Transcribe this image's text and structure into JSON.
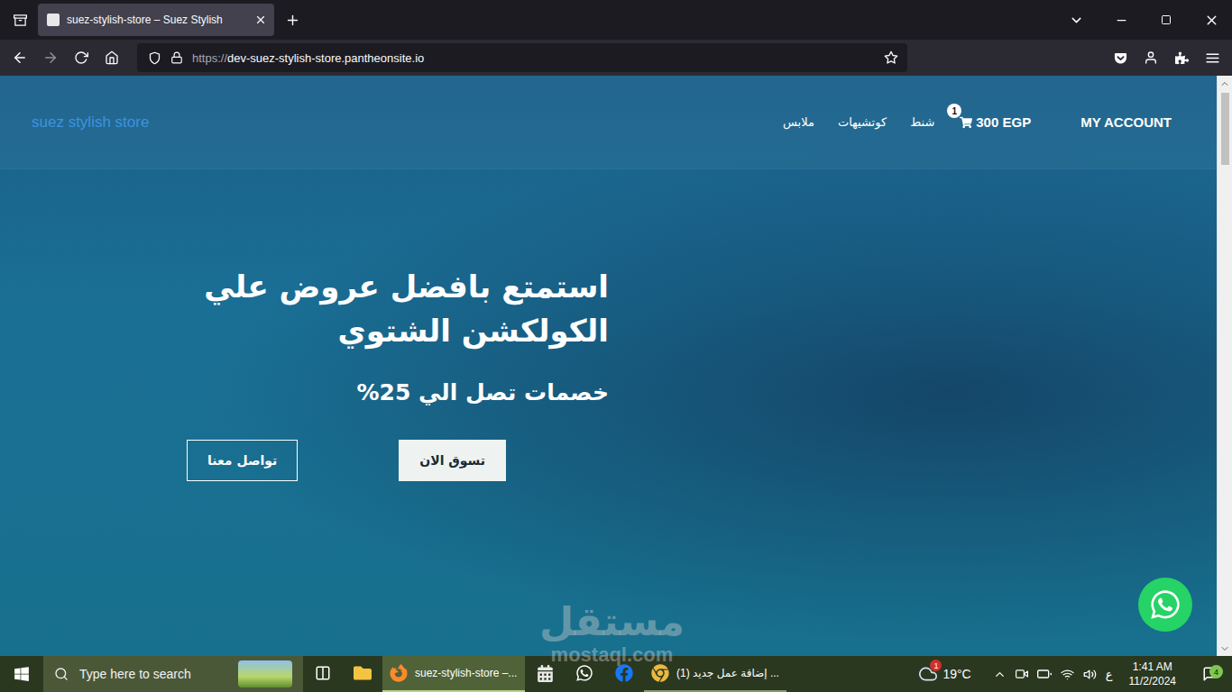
{
  "browser": {
    "tabs": [
      {
        "title": "suez-stylish-store – Suez Stylish",
        "selected": true
      }
    ],
    "url": {
      "scheme": "https://",
      "host": "dev-suez-stylish-store.pantheonsite.io"
    }
  },
  "site": {
    "logo": "suez stylish store",
    "nav": [
      {
        "label": "ملابس"
      },
      {
        "label": "كوتشيهات"
      },
      {
        "label": "شنط"
      }
    ],
    "cart": {
      "count": "1",
      "total": "300 EGP"
    },
    "account": "MY ACCOUNT"
  },
  "hero": {
    "heading": [
      "استمتع بافضل عروض علي",
      "الكولكشن الشتوي"
    ],
    "subheading": "خصمات تصل الي 25%",
    "buttons": [
      {
        "label": "تواصل معنا",
        "kind": "outline"
      },
      {
        "label": "تسوق الان",
        "kind": "filled"
      }
    ]
  },
  "watermark": {
    "arabic": "مستقل",
    "latin": "mostaql.com"
  },
  "taskbar": {
    "search_placeholder": "Type here to search",
    "apps": [
      {
        "kind": "icon",
        "label": "",
        "selected": false
      },
      {
        "kind": "icon",
        "label": "",
        "selected": false
      },
      {
        "kind": "labeled",
        "label": "suez-stylish-store –...",
        "selected": true
      },
      {
        "kind": "icon",
        "label": "",
        "selected": false
      },
      {
        "kind": "icon",
        "label": "",
        "selected": false
      },
      {
        "kind": "icon",
        "label": "",
        "selected": false
      },
      {
        "kind": "labeled",
        "label": "(1) إضافة عمل جديد ...",
        "selected": false
      }
    ],
    "weather": {
      "temp": "19°C",
      "badge": "1"
    },
    "language": "ع",
    "time": "1:41 AM",
    "date": "11/2/2024",
    "notifications": "4"
  }
}
